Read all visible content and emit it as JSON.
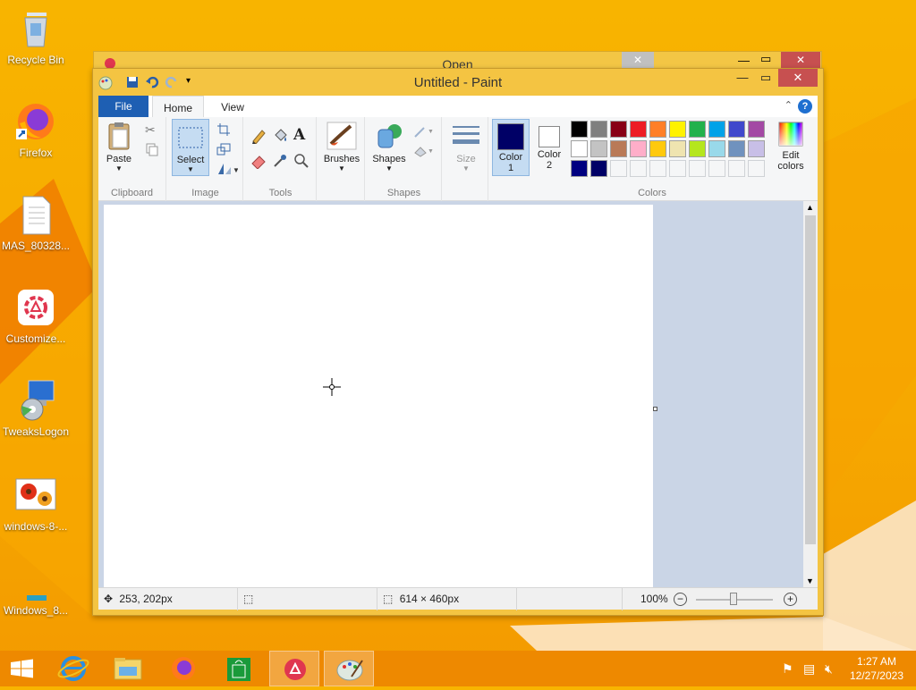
{
  "desktop": {
    "icons": [
      {
        "label": "Recycle Bin"
      },
      {
        "label": "Firefox"
      },
      {
        "label": "MAS_80328..."
      },
      {
        "label": "Customize..."
      },
      {
        "label": "TweaksLogon"
      },
      {
        "label": "windows-8-..."
      },
      {
        "label": "Windows_8..."
      }
    ]
  },
  "back_window": {
    "title": "Open"
  },
  "paint": {
    "title": "Untitled - Paint",
    "tabs": {
      "file": "File",
      "home": "Home",
      "view": "View"
    },
    "groups": {
      "clipboard": {
        "label": "Clipboard",
        "paste": "Paste"
      },
      "image": {
        "label": "Image",
        "select": "Select"
      },
      "tools": {
        "label": "Tools"
      },
      "brushes": {
        "label": "Brushes"
      },
      "shapes": {
        "label": "Shapes",
        "shapes": "Shapes"
      },
      "size": {
        "label": "Size"
      },
      "colors": {
        "label": "Colors",
        "color1_top": "Color",
        "color1_bottom": "1",
        "color2_top": "Color",
        "color2_bottom": "2",
        "edit_top": "Edit",
        "edit_bottom": "colors",
        "color1": "#000066",
        "color2": "#ffffff",
        "palette_row1": [
          "#000000",
          "#7f7f7f",
          "#880015",
          "#ed1c24",
          "#ff7f27",
          "#fff200",
          "#22b14c",
          "#00a2e8",
          "#3f48cc",
          "#a349a4"
        ],
        "palette_row2": [
          "#ffffff",
          "#c3c3c3",
          "#b97a57",
          "#ffaec9",
          "#ffc90e",
          "#efe4b0",
          "#b5e61d",
          "#99d9ea",
          "#7092be",
          "#c8bfe7"
        ],
        "palette_row3": [
          "#000080",
          "#000066",
          "#f5f6f7",
          "#f5f6f7",
          "#f5f6f7",
          "#f5f6f7",
          "#f5f6f7",
          "#f5f6f7",
          "#f5f6f7",
          "#f5f6f7"
        ]
      }
    },
    "status": {
      "cursor_pos": "253, 202px",
      "canvas_size": "614 × 460px",
      "zoom": "100%"
    }
  },
  "taskbar": {
    "time": "1:27 AM",
    "date": "12/27/2023"
  }
}
